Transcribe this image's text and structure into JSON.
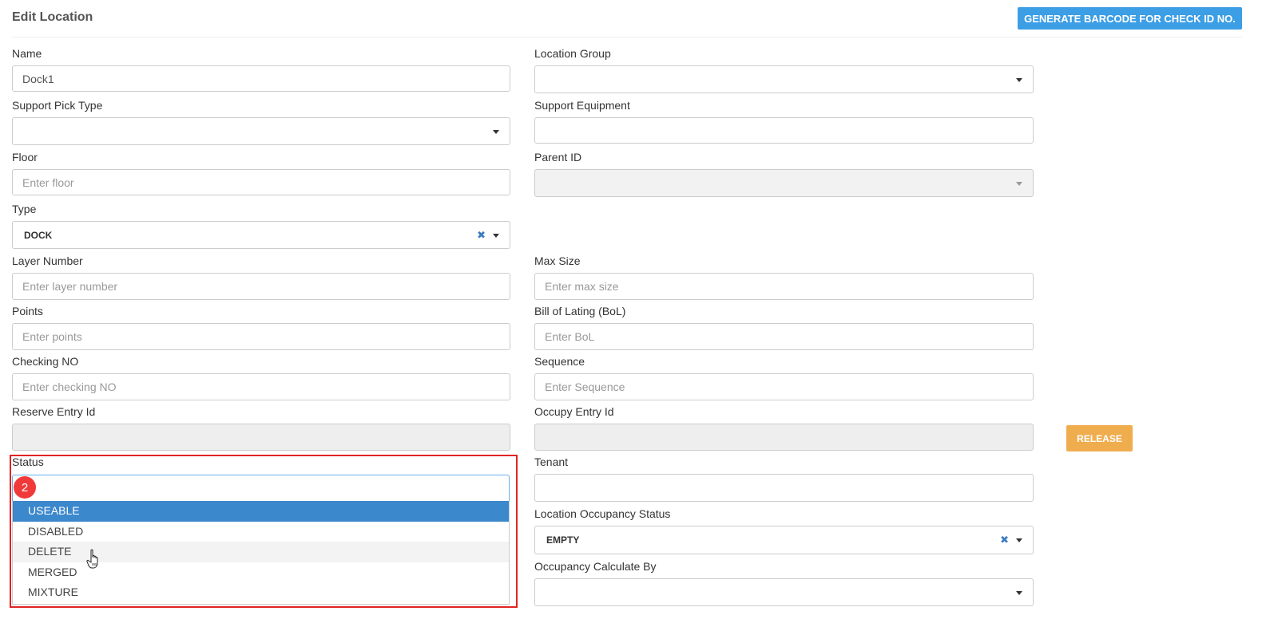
{
  "header": {
    "title": "Edit Location",
    "generate_button": "GENERATE BARCODE FOR CHECK ID NO."
  },
  "form": {
    "name": {
      "label": "Name",
      "value": "Dock1"
    },
    "location_group": {
      "label": "Location Group",
      "value": ""
    },
    "support_pick_type": {
      "label": "Support Pick Type",
      "value": ""
    },
    "support_equipment": {
      "label": "Support Equipment",
      "value": ""
    },
    "floor": {
      "label": "Floor",
      "placeholder": "Enter floor"
    },
    "parent_id": {
      "label": "Parent ID",
      "value": ""
    },
    "type": {
      "label": "Type",
      "value": "DOCK",
      "clear": "✖"
    },
    "layer_number": {
      "label": "Layer Number",
      "placeholder": "Enter layer number"
    },
    "max_size": {
      "label": "Max Size",
      "placeholder": "Enter max size"
    },
    "points": {
      "label": "Points",
      "placeholder": "Enter points"
    },
    "bol": {
      "label": "Bill of Lating (BoL)",
      "placeholder": "Enter BoL"
    },
    "checking_no": {
      "label": "Checking NO",
      "placeholder": "Enter checking NO"
    },
    "sequence": {
      "label": "Sequence",
      "placeholder": "Enter Sequence"
    },
    "reserve_entry_id": {
      "label": "Reserve Entry Id",
      "value": ""
    },
    "occupy_entry_id": {
      "label": "Occupy Entry Id",
      "value": ""
    },
    "release_button": "RELEASE",
    "status": {
      "label": "Status",
      "options": [
        "USEABLE",
        "DISABLED",
        "DELETE",
        "MERGED",
        "MIXTURE"
      ],
      "highlighted_option": "USEABLE",
      "hovered_option": "DELETE"
    },
    "tenant": {
      "label": "Tenant",
      "value": ""
    },
    "location_occupancy_status": {
      "label": "Location Occupancy Status",
      "value": "EMPTY",
      "clear": "✖"
    },
    "occupancy_calculate_by": {
      "label": "Occupancy Calculate By",
      "value": ""
    }
  },
  "annotation": {
    "step_badge": "2",
    "highlight_color": "#e02424"
  },
  "colors": {
    "primary": "#3c9ee5",
    "warning": "#f0ad4e",
    "selected": "#3c88cc"
  },
  "icons": {
    "caret": "caret-down-icon",
    "clear": "clear-icon",
    "cursor": "hand-pointer-icon"
  }
}
